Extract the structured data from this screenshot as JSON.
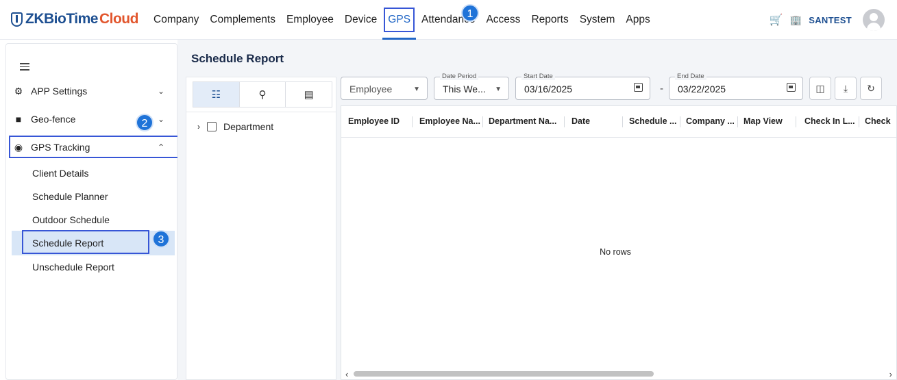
{
  "header": {
    "logo_zk": "ZKBioTime",
    "logo_cloud": "Cloud",
    "nav": [
      "Company",
      "Complements",
      "Employee",
      "Device",
      "GPS",
      "Attendance",
      "Access",
      "Reports",
      "System",
      "Apps"
    ],
    "active_nav": "GPS",
    "username": "SANTEST"
  },
  "steps": [
    "1",
    "2",
    "3"
  ],
  "sidebar": {
    "items": [
      {
        "label": "APP Settings",
        "icon": "gear-icon"
      },
      {
        "label": "Geo-fence",
        "icon": "message-square-icon"
      },
      {
        "label": "GPS Tracking",
        "icon": "location-target-icon"
      }
    ],
    "sub_items": [
      "Client Details",
      "Schedule Planner",
      "Outdoor Schedule",
      "Schedule Report",
      "Unschedule Report"
    ],
    "active_sub": "Schedule Report"
  },
  "main": {
    "title": "Schedule Report",
    "tree": {
      "tabs": [
        "hierarchy-icon",
        "location-pin-icon",
        "id-badge-icon"
      ],
      "root": "Department"
    },
    "filters": {
      "employee": "Employee",
      "date_period_label": "Date Period",
      "date_period_value": "This We...",
      "start_date_label": "Start Date",
      "start_date_value": "03/16/2025",
      "separator": "-",
      "end_date_label": "End Date",
      "end_date_value": "03/22/2025"
    },
    "table": {
      "columns": [
        "Employee ID",
        "Employee Na...",
        "Department Na...",
        "Date",
        "Schedule ...",
        "Company ...",
        "Map View",
        "Check In L...",
        "Check"
      ],
      "empty_text": "No rows"
    }
  }
}
